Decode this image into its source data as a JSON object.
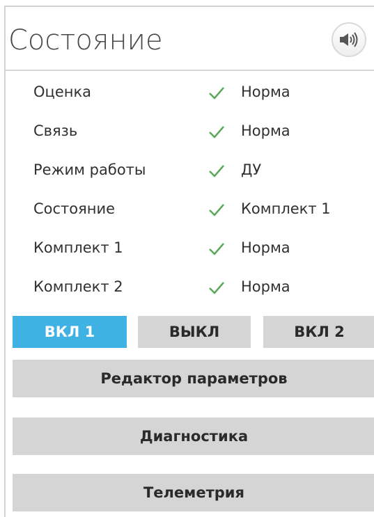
{
  "panel": {
    "title": "Состояние",
    "sound_icon": "speaker-volume-icon"
  },
  "status_rows": [
    {
      "label": "Оценка",
      "icon": "check-icon",
      "value": "Норма"
    },
    {
      "label": "Связь",
      "icon": "check-icon",
      "value": "Норма"
    },
    {
      "label": "Режим работы",
      "icon": "check-icon",
      "value": "ДУ"
    },
    {
      "label": "Состояние",
      "icon": "check-icon",
      "value": "Комплект 1"
    },
    {
      "label": "Комплект 1",
      "icon": "check-icon",
      "value": "Норма"
    },
    {
      "label": "Комплект 2",
      "icon": "check-icon",
      "value": "Норма"
    }
  ],
  "mode_buttons": [
    {
      "label": "ВКЛ 1",
      "active": true
    },
    {
      "label": "ВЫКЛ",
      "active": false
    },
    {
      "label": "ВКЛ 2",
      "active": false
    }
  ],
  "actions": {
    "params_editor": "Редактор параметров",
    "diagnostics": "Диагностика",
    "telemetry": "Телеметрия"
  },
  "colors": {
    "active_button": "#3fb1e3",
    "inactive_button": "#d5d5d5",
    "check": "#5aa95a"
  }
}
